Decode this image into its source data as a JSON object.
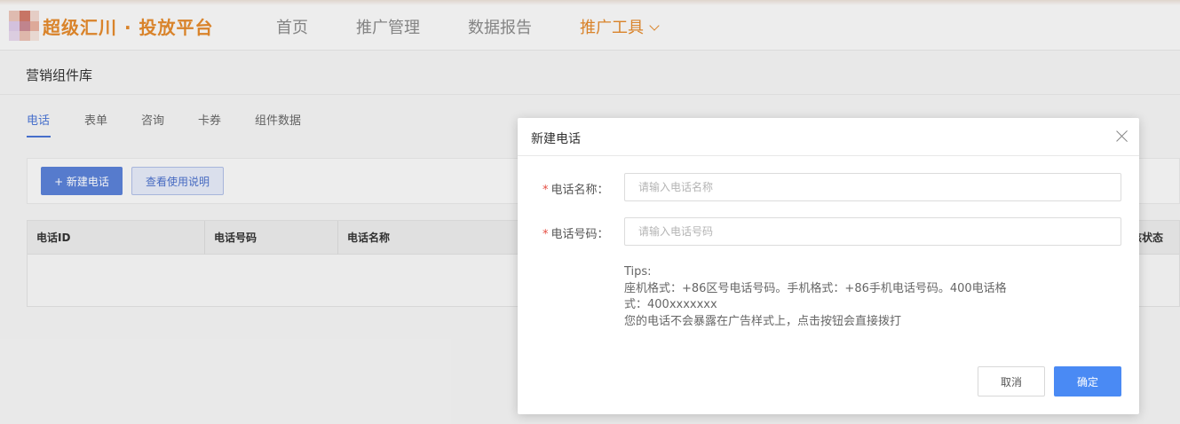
{
  "brand": {
    "name": "超级汇川 · 投放平台",
    "accent_color": "#e2892c"
  },
  "nav": {
    "items": [
      {
        "label": "首页",
        "active": false
      },
      {
        "label": "推广管理",
        "active": false
      },
      {
        "label": "数据报告",
        "active": false
      },
      {
        "label": "推广工具",
        "active": true,
        "icon": "chevron-down-icon"
      }
    ]
  },
  "page": {
    "title": "营销组件库",
    "tabs": [
      {
        "label": "电话",
        "active": true
      },
      {
        "label": "表单",
        "active": false
      },
      {
        "label": "咨询",
        "active": false
      },
      {
        "label": "卡券",
        "active": false
      },
      {
        "label": "组件数据",
        "active": false
      }
    ],
    "toolbar": {
      "new_button": "+ 新建电话",
      "help_button": "查看使用说明"
    },
    "table": {
      "columns": [
        "电话ID",
        "电话号码",
        "电话名称",
        "核状态"
      ]
    }
  },
  "modal": {
    "title": "新建电话",
    "close_icon": "close-icon",
    "fields": [
      {
        "required_mark": "*",
        "label": "电话名称：",
        "placeholder": "请输入电话名称",
        "value": ""
      },
      {
        "required_mark": "*",
        "label": "电话号码：",
        "placeholder": "请输入电话号码",
        "value": ""
      }
    ],
    "tips": [
      "Tips:",
      "座机格式：+86区号电话号码。手机格式：+86手机电话号码。400电话格",
      "式：400xxxxxxx",
      "您的电话不会暴露在广告样式上，点击按钮会直接拨打"
    ],
    "cancel_label": "取消",
    "ok_label": "确定",
    "primary_color": "#4a8af4"
  }
}
